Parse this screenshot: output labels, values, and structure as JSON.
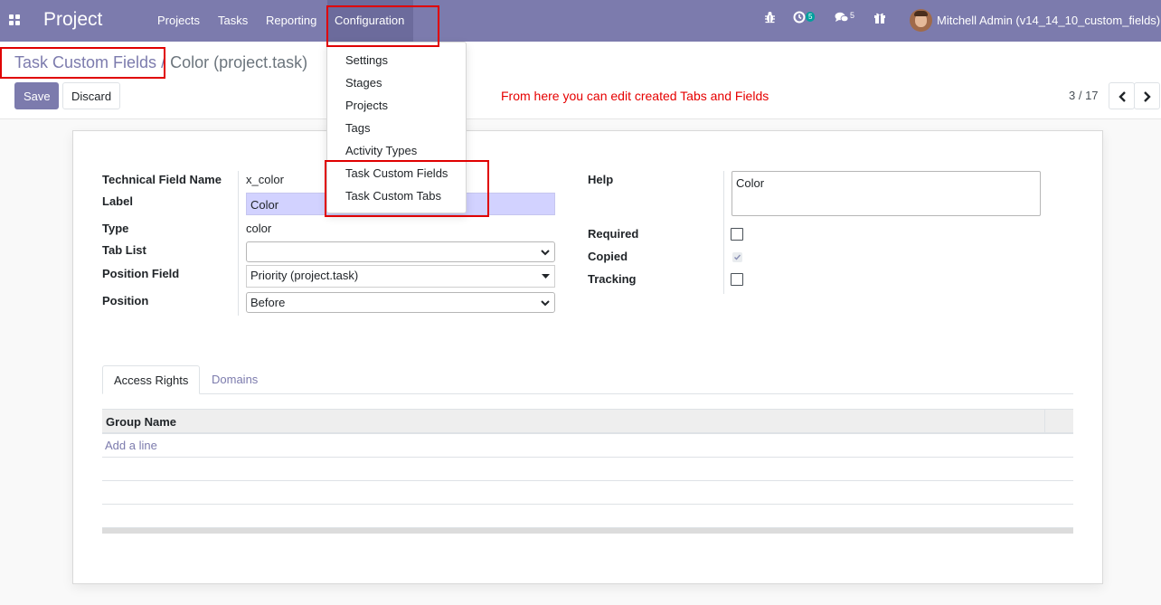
{
  "navbar": {
    "app_name": "Project",
    "menu": [
      "Projects",
      "Tasks",
      "Reporting",
      "Configuration"
    ],
    "activity_count": "5",
    "message_count": "5",
    "user_name": "Mitchell Admin (v14_14_10_custom_fields)"
  },
  "config_menu": {
    "items": [
      "Settings",
      "Stages",
      "Projects",
      "Tags",
      "Activity Types",
      "Task Custom Fields",
      "Task Custom Tabs"
    ]
  },
  "breadcrumb": {
    "parent": "Task Custom Fields",
    "separator": "/",
    "current": "Color (project.task)"
  },
  "buttons": {
    "save": "Save",
    "discard": "Discard"
  },
  "annotation": "From here you can edit created Tabs and Fields",
  "pager": {
    "value": "3 / 17"
  },
  "form": {
    "technical_field_name_label": "Technical Field Name",
    "technical_field_name": "x_color",
    "label_label": "Label",
    "label": "Color",
    "type_label": "Type",
    "type": "color",
    "tab_list_label": "Tab List",
    "tab_list": "",
    "position_field_label": "Position Field",
    "position_field": "Priority (project.task)",
    "position_label": "Position",
    "position": "Before",
    "help_label": "Help",
    "help": "Color",
    "required_label": "Required",
    "required": false,
    "copied_label": "Copied",
    "copied": true,
    "tracking_label": "Tracking",
    "tracking": false
  },
  "tabs": [
    "Access Rights",
    "Domains"
  ],
  "table": {
    "column": "Group Name",
    "add_line": "Add a line"
  },
  "colors": {
    "brand": "#7c7bad",
    "highlight": "#e00000"
  }
}
